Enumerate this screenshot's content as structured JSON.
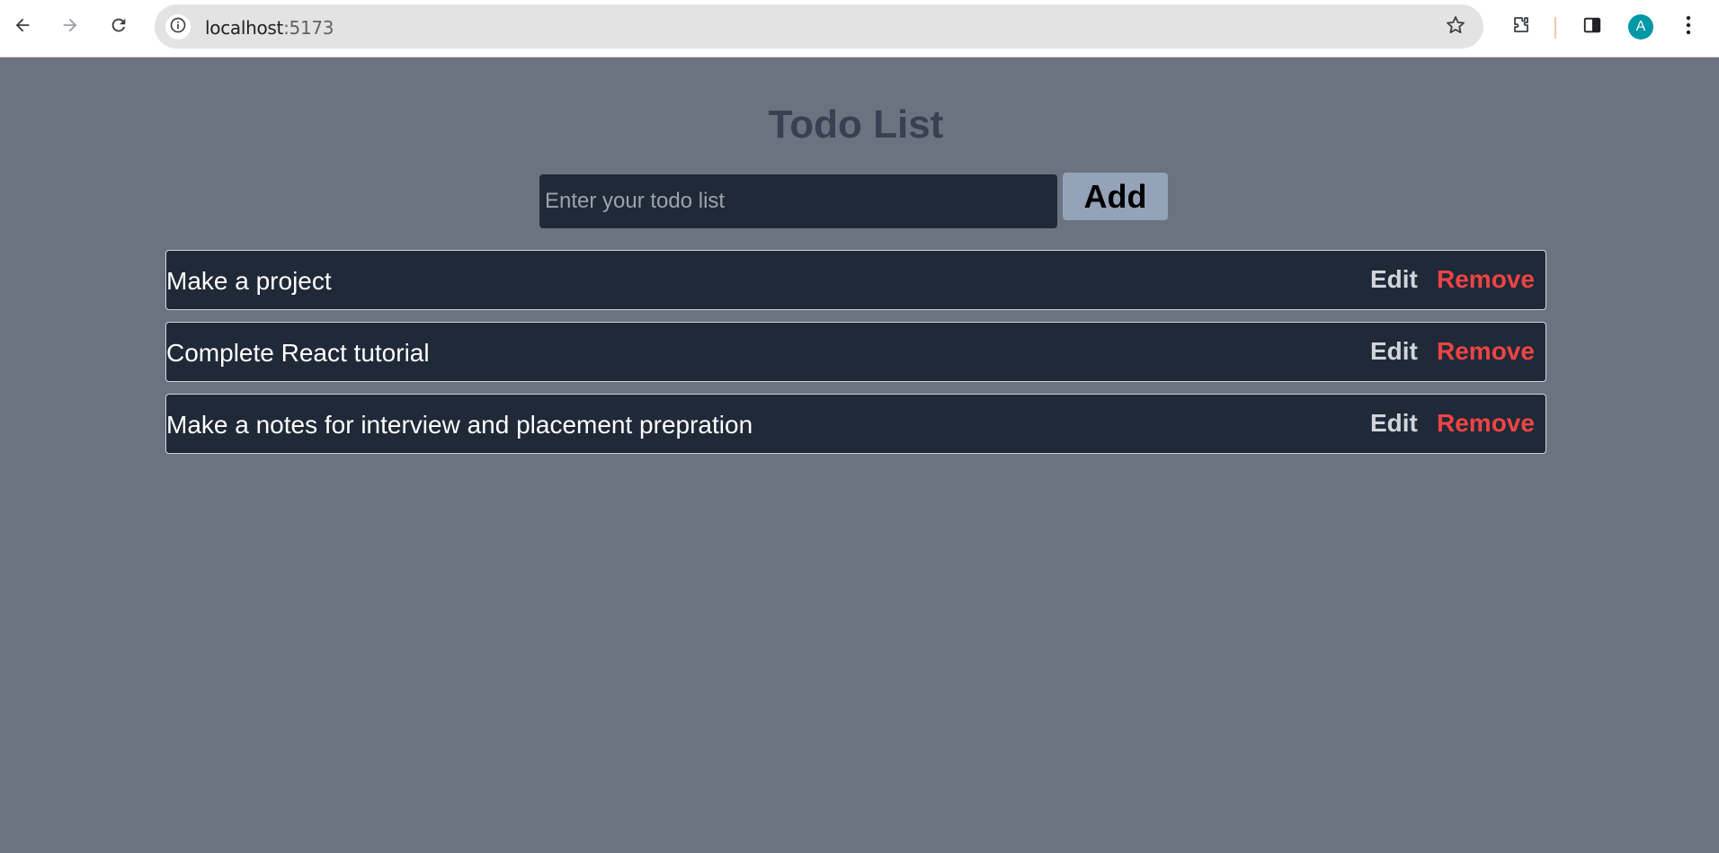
{
  "browser": {
    "url_host": "localhost",
    "url_port": ":5173",
    "profile_initial": "A",
    "icons": {
      "back": "arrow-left-icon",
      "forward": "arrow-right-icon",
      "reload": "reload-icon",
      "site_info": "info-icon",
      "bookmark": "star-icon",
      "extensions": "puzzle-icon",
      "side_panel": "side-panel-icon",
      "menu": "kebab-menu-icon"
    },
    "colors": {
      "avatar_bg": "#0097a7"
    }
  },
  "app": {
    "title": "Todo List",
    "input_placeholder": "Enter your todo list",
    "input_value": "",
    "add_label": "Add",
    "todos": [
      {
        "text": "Make a project",
        "edit_label": "Edit",
        "remove_label": "Remove"
      },
      {
        "text": "Complete React tutorial",
        "edit_label": "Edit",
        "remove_label": "Remove"
      },
      {
        "text": "Make a notes for interview and placement prepration",
        "edit_label": "Edit",
        "remove_label": "Remove"
      }
    ],
    "colors": {
      "background": "#6b7280",
      "card": "#1f2937",
      "title": "#374151",
      "add_button": "#94a3b8",
      "remove": "#ef4444"
    }
  }
}
